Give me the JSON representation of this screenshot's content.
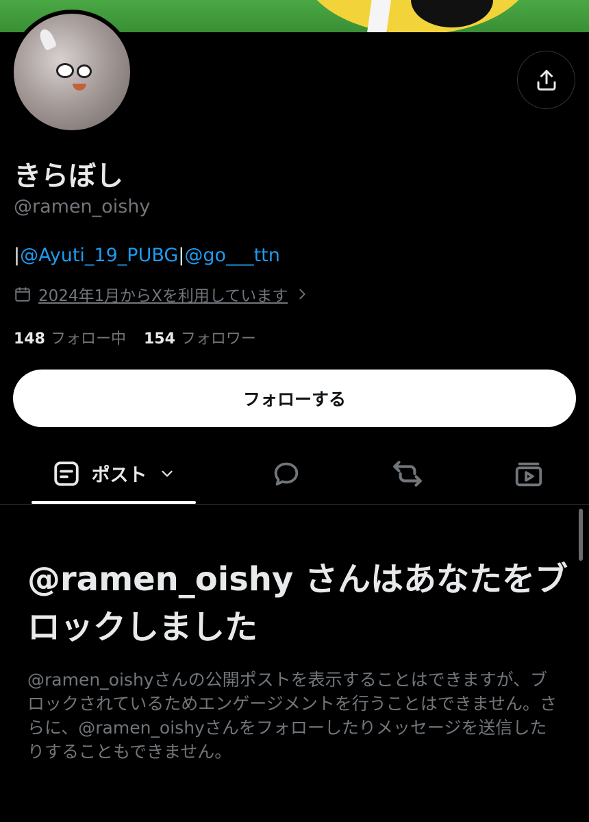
{
  "profile": {
    "display_name": "きらぼし",
    "handle": "@ramen_oishy",
    "bio": {
      "prefix": "|",
      "mention1": "@Ayuti_19_PUBG",
      "separator": "|",
      "mention2": "@go___ttn"
    },
    "joined": "2024年1月からXを利用しています",
    "following_count": "148",
    "following_label": "フォロー中",
    "followers_count": "154",
    "followers_label": "フォロワー"
  },
  "actions": {
    "follow_label": "フォローする"
  },
  "tabs": {
    "posts_label": "ポスト"
  },
  "blocked": {
    "title": "@ramen_oishy さんはあなたをブロックしました",
    "description": "@ramen_oishyさんの公開ポストを表示することはできますが、ブロックされているためエンゲージメントを行うことはできません。さらに、@ramen_oishyさんをフォローしたりメッセージを送信したりすることもできません。"
  },
  "colors": {
    "background": "#000000",
    "accent_link": "#1d9bf0",
    "muted_text": "#71767b",
    "primary_text": "#e7e9ea"
  },
  "icons": {
    "share": "share-icon",
    "calendar": "calendar-icon",
    "chevron": "chevron-right-icon",
    "posts": "posts-icon",
    "dropdown": "chevron-down-icon",
    "replies": "reply-bubble-icon",
    "reposts": "repost-icon",
    "media": "media-icon"
  }
}
